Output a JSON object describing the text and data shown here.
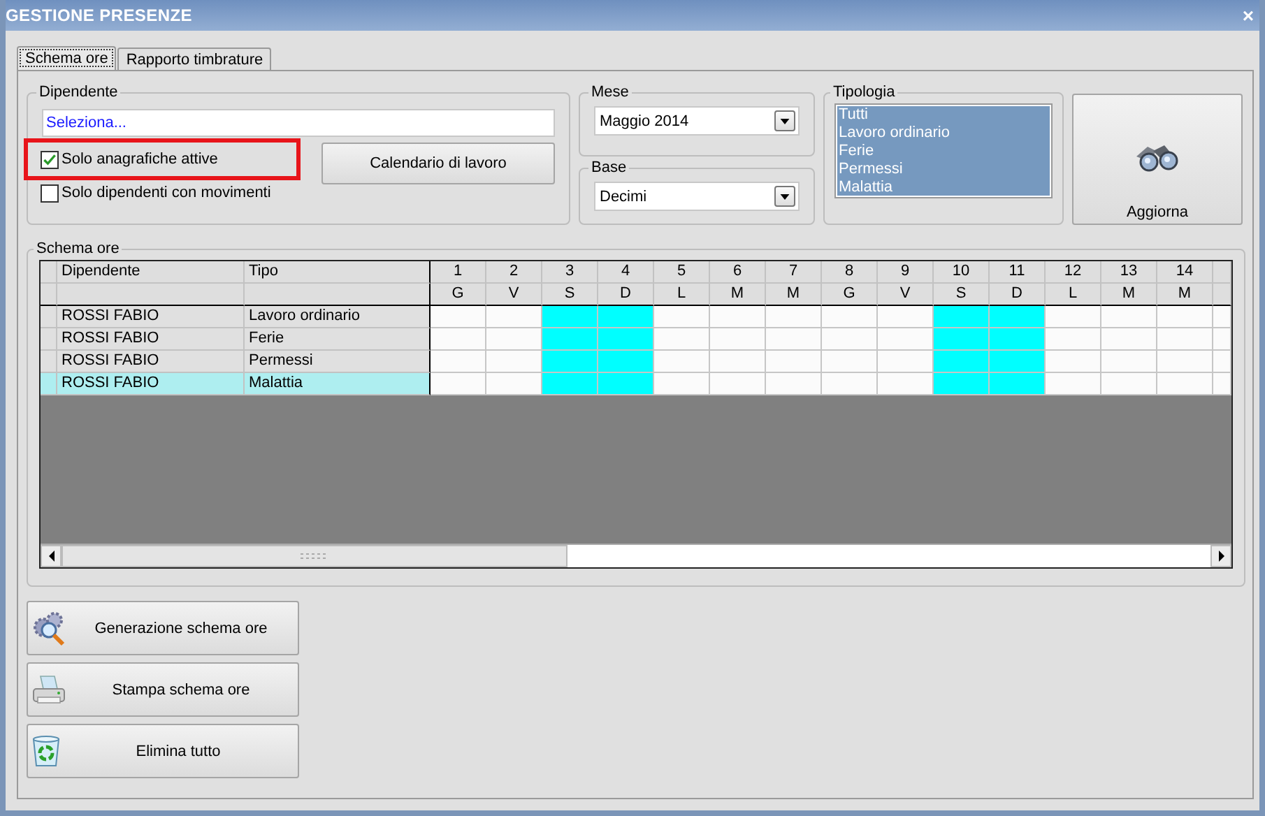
{
  "window": {
    "title": "GESTIONE PRESENZE",
    "close": "×"
  },
  "tabs": [
    {
      "label": "Schema ore",
      "selected": true
    },
    {
      "label": "Rapporto timbrature",
      "selected": false
    }
  ],
  "dipendente": {
    "label": "Dipendente",
    "value": "Seleziona...",
    "button": "Calendario di lavoro",
    "options": [
      {
        "label": "Solo anagrafiche attive",
        "checked": true,
        "highlighted": true
      },
      {
        "label": "Solo dipendenti con movimenti",
        "checked": false,
        "highlighted": false
      }
    ]
  },
  "mese": {
    "label": "Mese",
    "value": "Maggio 2014"
  },
  "base": {
    "label": "Base",
    "value": "Decimi"
  },
  "tipologia": {
    "label": "Tipologia",
    "items": [
      {
        "label": "Tutti",
        "selected": true
      },
      {
        "label": "Lavoro ordinario",
        "selected": true
      },
      {
        "label": "Ferie",
        "selected": true
      },
      {
        "label": "Permessi",
        "selected": true
      },
      {
        "label": "Malattia",
        "selected": true
      }
    ]
  },
  "refresh_button": "Aggiorna",
  "schema": {
    "label": "Schema ore",
    "columns": [
      "Dipendente",
      "Tipo"
    ],
    "days": [
      {
        "day": "1",
        "weekday": "G",
        "weekend": false
      },
      {
        "day": "2",
        "weekday": "V",
        "weekend": false
      },
      {
        "day": "3",
        "weekday": "S",
        "weekend": true
      },
      {
        "day": "4",
        "weekday": "D",
        "weekend": true
      },
      {
        "day": "5",
        "weekday": "L",
        "weekend": false
      },
      {
        "day": "6",
        "weekday": "M",
        "weekend": false
      },
      {
        "day": "7",
        "weekday": "M",
        "weekend": false
      },
      {
        "day": "8",
        "weekday": "G",
        "weekend": false
      },
      {
        "day": "9",
        "weekday": "V",
        "weekend": false
      },
      {
        "day": "10",
        "weekday": "S",
        "weekend": true
      },
      {
        "day": "11",
        "weekday": "D",
        "weekend": true
      },
      {
        "day": "12",
        "weekday": "L",
        "weekend": false
      },
      {
        "day": "13",
        "weekday": "M",
        "weekend": false
      },
      {
        "day": "14",
        "weekday": "M",
        "weekend": false
      }
    ],
    "rows": [
      {
        "dipendente": "ROSSI FABIO",
        "tipo": "Lavoro ordinario",
        "selected": false
      },
      {
        "dipendente": "ROSSI FABIO",
        "tipo": "Ferie",
        "selected": false
      },
      {
        "dipendente": "ROSSI FABIO",
        "tipo": "Permessi",
        "selected": false
      },
      {
        "dipendente": "ROSSI FABIO",
        "tipo": "Malattia",
        "selected": true
      }
    ]
  },
  "actions": [
    {
      "label": "Generazione schema ore",
      "kind": "generate"
    },
    {
      "label": "Stampa schema ore",
      "kind": "print"
    },
    {
      "label": "Elimina tutto",
      "kind": "delete"
    }
  ]
}
